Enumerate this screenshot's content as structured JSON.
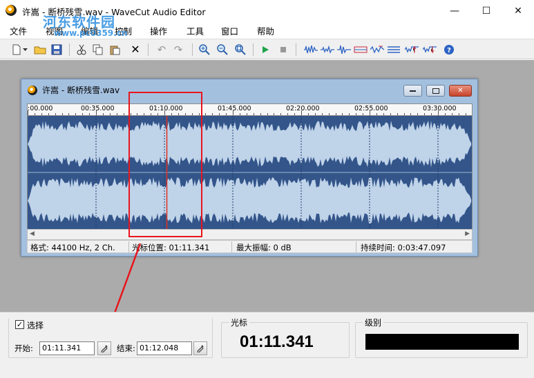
{
  "window": {
    "title": "许嵩 - 断桥残雪.wav - WaveCut Audio Editor",
    "minimize_glyph": "—",
    "maximize_glyph": "☐",
    "close_glyph": "✕"
  },
  "watermark": {
    "text": "河东软件园",
    "url": "www.pc0359.cn"
  },
  "menu": [
    "文件",
    "视图",
    "编辑",
    "控制",
    "操作",
    "工具",
    "窗口",
    "帮助"
  ],
  "toolbar_icons": [
    "new-file-icon",
    "dropdown-icon",
    "open-folder-icon",
    "save-icon",
    "cut-icon",
    "copy-icon",
    "paste-icon",
    "delete-icon",
    "undo-icon",
    "redo-icon",
    "zoom-in-icon",
    "zoom-out-icon",
    "zoom-fit-icon",
    "play-icon",
    "stop-icon",
    "wave-effect-1-icon",
    "wave-effect-2-icon",
    "wave-effect-3-icon",
    "wave-effect-4-icon",
    "wave-effect-5-icon",
    "wave-effect-6-icon",
    "wave-effect-7-icon",
    "wave-effect-8-icon",
    "help-icon"
  ],
  "child_window": {
    "title": "许嵩 - 断桥残雪.wav",
    "ruler_labels": [
      ":00.000",
      "00:35.000",
      "01:10.000",
      "01:45.000",
      "02:20.000",
      "02:55.000",
      "03:30.000"
    ],
    "status": {
      "format": "格式: 44100 Hz, 2 Ch.",
      "cursor": "光标位置: 01:11.341",
      "max_amplitude": "最大振幅: 0 dB",
      "duration": "持续时间: 0:03:47.097"
    },
    "cursor_fraction": 0.3134,
    "wave_colors": {
      "background": "#33558a",
      "wave": "#bfd3e9",
      "cursor": "#e03020"
    }
  },
  "selection": {
    "group_label": "选择",
    "checked": true,
    "start_label": "开始:",
    "start_value": "01:11.341",
    "end_label": "结束:",
    "end_value": "01:12.048"
  },
  "cursor_panel": {
    "label": "光标",
    "value": "01:11.341"
  },
  "level_panel": {
    "label": "级别"
  },
  "colors": {
    "annotation": "#e8141c",
    "workspace": "#ababab"
  }
}
